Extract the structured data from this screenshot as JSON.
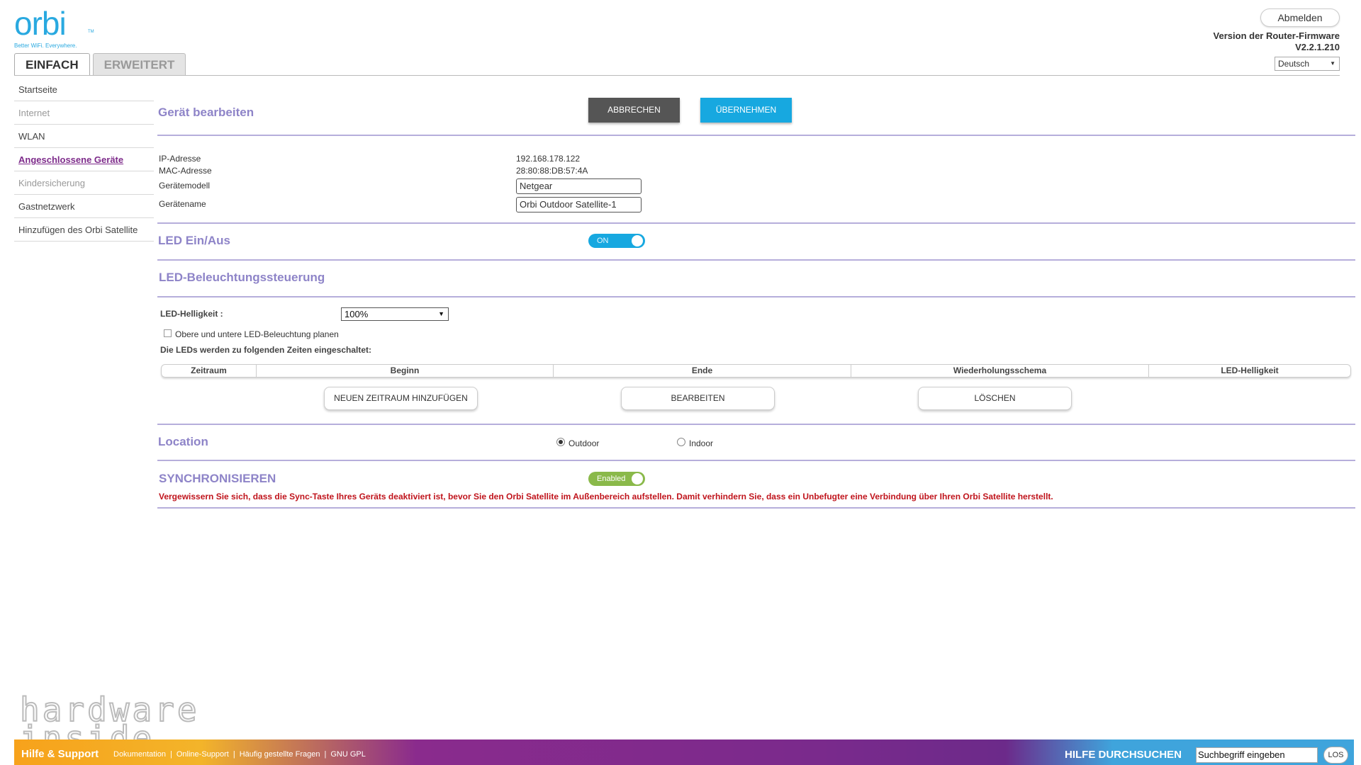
{
  "logo": {
    "text": "orbi",
    "tm": "TM",
    "tagline": "Better WiFi. Everywhere."
  },
  "tabs": [
    {
      "label": "EINFACH"
    },
    {
      "label": "ERWEITERT"
    }
  ],
  "header": {
    "logout_label": "Abmelden",
    "firmware_label": "Version der Router-Firmware",
    "firmware_version": "V2.2.1.210",
    "language": "Deutsch"
  },
  "sidebar": {
    "items": [
      {
        "label": "Startseite"
      },
      {
        "label": "Internet"
      },
      {
        "label": "WLAN"
      },
      {
        "label": "Angeschlossene Geräte"
      },
      {
        "label": "Kindersicherung"
      },
      {
        "label": "Gastnetzwerk"
      },
      {
        "label": "Hinzufügen des Orbi Satellite"
      }
    ]
  },
  "main": {
    "title": "Gerät bearbeiten",
    "cancel_label": "ABBRECHEN",
    "apply_label": "ÜBERNEHMEN",
    "device": {
      "ip_label": "IP-Adresse",
      "ip_value": "192.168.178.122",
      "mac_label": "MAC-Adresse",
      "mac_value": "28:80:88:DB:57:4A",
      "model_label": "Gerätemodell",
      "model_value": "Netgear",
      "name_label": "Gerätename",
      "name_value": "Orbi Outdoor Satellite-1"
    },
    "led": {
      "title": "LED Ein/Aus",
      "toggle_label": "ON"
    },
    "led_control": {
      "title": "LED-Beleuchtungssteuerung",
      "brightness_label": "LED-Helligkeit :",
      "brightness_value": "100%",
      "schedule_checkbox_label": "Obere und untere LED-Beleuchtung planen",
      "schedule_info": "Die LEDs werden zu folgenden Zeiten eingeschaltet:",
      "table_headers": [
        "Zeitraum",
        "Beginn",
        "Ende",
        "Wiederholungsschema",
        "LED-Helligkeit"
      ],
      "add_button": "NEUEN ZEITRAUM HINZUFÜGEN",
      "edit_button": "BEARBEITEN",
      "delete_button": "LÖSCHEN"
    },
    "location": {
      "title": "Location",
      "option_outdoor": "Outdoor",
      "option_indoor": "Indoor"
    },
    "sync": {
      "title": "SYNCHRONISIEREN",
      "toggle_label": "Enabled",
      "warning": "Vergewissern Sie sich, dass die Sync-Taste Ihres Geräts deaktiviert ist, bevor Sie den Orbi Satellite im Außenbereich aufstellen. Damit verhindern Sie, dass ein Unbefugter eine Verbindung über Ihren Orbi Satellite herstellt."
    }
  },
  "footer": {
    "help_title": "Hilfe & Support",
    "links": [
      "Dokumentation",
      "Online-Support",
      "Häufig gestellte Fragen",
      "GNU GPL"
    ],
    "search_title": "HILFE DURCHSUCHEN",
    "search_placeholder": "Suchbegriff eingeben",
    "search_button": "LOS"
  },
  "watermark": {
    "line1": "hardware",
    "line2": "inside"
  },
  "colors": {
    "accent": "#17a8e0",
    "section_title": "#8e84c8",
    "warning": "#c0141c",
    "active_nav": "#7d2a8a"
  }
}
